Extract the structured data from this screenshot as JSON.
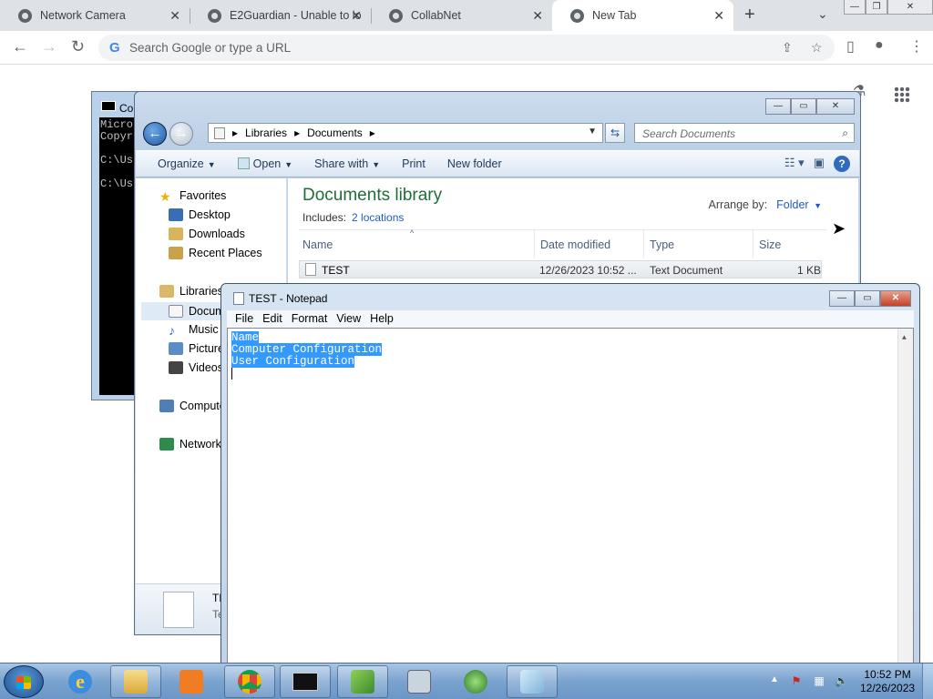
{
  "browser": {
    "tabs": [
      {
        "title": "Network Camera"
      },
      {
        "title": "E2Guardian - Unable to lo"
      },
      {
        "title": "CollabNet"
      },
      {
        "title": "New Tab"
      }
    ],
    "new_tab": "+",
    "omnibox_placeholder": "Search Google or type a URL",
    "google_glyph": "G"
  },
  "cmd_window": {
    "title_fragment": "Co",
    "lines": [
      "Micro",
      "Copyr",
      "",
      "C:\\Us",
      "",
      "C:\\Us"
    ]
  },
  "explorer": {
    "breadcrumb": [
      "Libraries",
      "Documents"
    ],
    "search_placeholder": "Search Documents",
    "commands": [
      "Organize",
      "Open",
      "Share with",
      "Print",
      "New folder"
    ],
    "nav": {
      "favorites_header": "Favorites",
      "favorites": [
        "Desktop",
        "Downloads",
        "Recent Places"
      ],
      "libraries_header": "Libraries",
      "libraries": [
        "Docum",
        "Music",
        "Picture",
        "Videos"
      ],
      "computer": "Compute",
      "network": "Network"
    },
    "library_title": "Documents library",
    "includes_label": "Includes:",
    "includes_link": "2 locations",
    "arrange_label": "Arrange by:",
    "arrange_value": "Folder",
    "columns": [
      "Name",
      "Date modified",
      "Type",
      "Size"
    ],
    "files": [
      {
        "name": "TEST",
        "modified": "12/26/2023 10:52 ...",
        "type": "Text Document",
        "size": "1 KB"
      }
    ],
    "details": {
      "name": "TE",
      "sub": "Te"
    }
  },
  "notepad": {
    "title": "TEST - Notepad",
    "menu": [
      "File",
      "Edit",
      "Format",
      "View",
      "Help"
    ],
    "selected_lines": [
      "Name",
      "Computer Configuration",
      "User Configuration"
    ]
  },
  "taskbar": {
    "time": "10:52 PM",
    "date": "12/26/2023"
  },
  "colors": {
    "accent_blue": "#3399ff",
    "library_title_green": "#1e6e38",
    "link_blue": "#1f5bc4",
    "taskbar": "#7aa3cf"
  }
}
